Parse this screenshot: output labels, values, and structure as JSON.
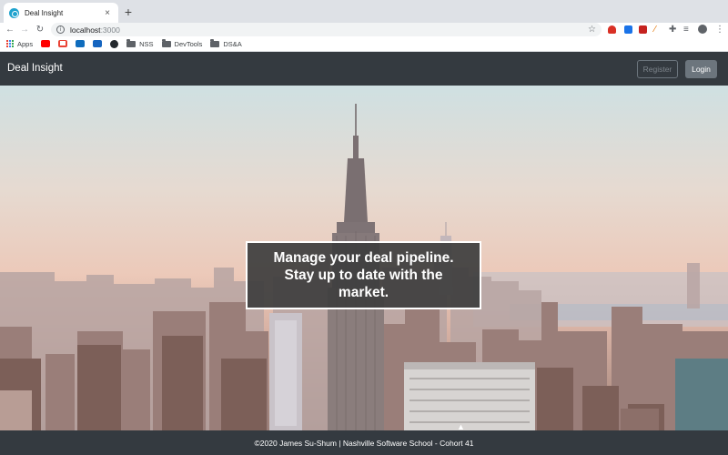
{
  "browser": {
    "tab_title": "Deal Insight",
    "tab_close": "×",
    "new_tab": "+",
    "url_host": "localhost",
    "url_port": ":3000",
    "bookmarks": [
      "Apps",
      "NSS",
      "DevTools",
      "DS&A"
    ]
  },
  "navbar": {
    "brand": "Deal Insight",
    "register_label": "Register",
    "login_label": "Login"
  },
  "hero": {
    "tagline": "Manage your deal pipeline. Stay up to date with the market."
  },
  "footer": {
    "text": "©2020 James Su-Shum | Nashville Software School - Cohort 41"
  },
  "colors": {
    "navbar_bg": "#343a40",
    "secondary_btn": "#6c757d"
  },
  "icons": [
    "back-arrow-icon",
    "forward-arrow-icon",
    "reload-icon",
    "info-icon",
    "star-icon",
    "extensions-icon",
    "profile-icon",
    "menu-icon"
  ]
}
